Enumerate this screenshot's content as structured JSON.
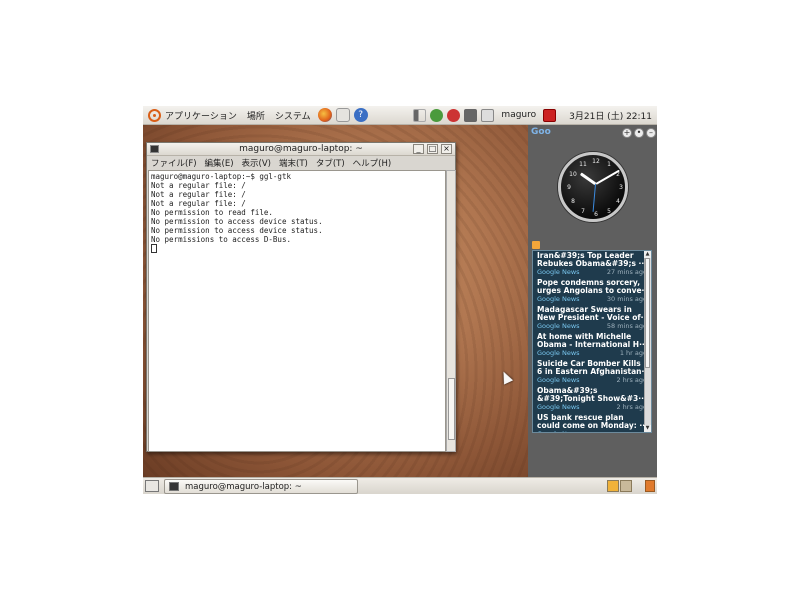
{
  "top_panel": {
    "menus": [
      "アプリケーション",
      "場所",
      "システム"
    ],
    "user": "maguro",
    "datetime": "3月21日 (土) 22:11"
  },
  "terminal": {
    "title": "maguro@maguro-laptop: ~",
    "menu": [
      "ファイル(F)",
      "編集(E)",
      "表示(V)",
      "端末(T)",
      "タブ(T)",
      "ヘルプ(H)"
    ],
    "lines": [
      "maguro@maguro-laptop:~$ ggl-gtk",
      "Not a regular file: /",
      "Not a regular file: /",
      "Not a regular file: /",
      "No permission to read file.",
      "No permission to access device status.",
      "No permission to access device status.",
      "No permissions to access D-Bus."
    ]
  },
  "sidebar": {
    "header": "Goo",
    "news": [
      {
        "title1": "Iran&#39;s Top Leader",
        "title2": "Rebukes Obama&#39;s ···",
        "source": "Google News",
        "age": "27 mins ago"
      },
      {
        "title1": "Pope condemns sorcery,",
        "title2": "urges Angolans to conve···",
        "source": "Google News",
        "age": "30 mins ago"
      },
      {
        "title1": "Madagascar Swears in",
        "title2": "New President - Voice of···",
        "source": "Google News",
        "age": "58 mins ago"
      },
      {
        "title1": "At home with Michelle",
        "title2": "Obama - International H···",
        "source": "Google News",
        "age": "1 hr ago"
      },
      {
        "title1": "Suicide Car Bomber Kills",
        "title2": "6 in Eastern Afghanistan···",
        "source": "Google News",
        "age": "2 hrs ago"
      },
      {
        "title1": "Obama&#39;s",
        "title2": "&#39;Tonight Show&#3···",
        "source": "Google News",
        "age": "2 hrs ago"
      },
      {
        "title1": "US bank rescue plan",
        "title2": "could come on Monday: ···",
        "source": "Google News",
        "age": ""
      }
    ]
  },
  "bottom_panel": {
    "task_label": "maguro@maguro-laptop: ~"
  },
  "colors": {
    "accent": "#d95e17",
    "news_bg": "#1f3b4d",
    "news_source": "#78c6ee"
  }
}
